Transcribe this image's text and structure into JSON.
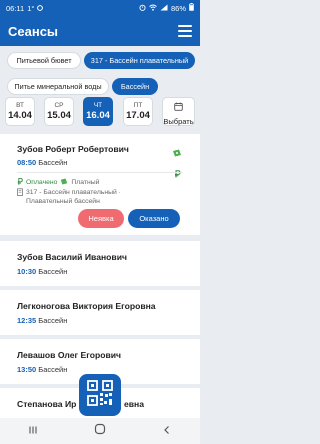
{
  "status": {
    "time": "06:11",
    "indicator": "1°",
    "battery": "86%"
  },
  "header": {
    "title": "Сеансы"
  },
  "filters": [
    {
      "label": "Питьевой бювет",
      "active": false
    },
    {
      "label": "317 - Бассейн плавательный",
      "active": true
    },
    {
      "label": "Питье минеральной воды",
      "active": false
    },
    {
      "label": "Бассейн",
      "active": true
    }
  ],
  "days": [
    {
      "weekday": "ВТ",
      "date": "14.04",
      "active": false
    },
    {
      "weekday": "СР",
      "date": "15.04",
      "active": false
    },
    {
      "weekday": "ЧТ",
      "date": "16.04",
      "active": true
    },
    {
      "weekday": "ПТ",
      "date": "17.04",
      "active": false
    }
  ],
  "date_picker": {
    "label": "Выбрать"
  },
  "sessions": [
    {
      "name": "Зубов Роберт Робертович",
      "time": "08:50",
      "procedure": "Бассейн",
      "expanded": true,
      "payment_status": "Оплачено",
      "payment_type": "Платный",
      "room_line1": "317 - Бассейн плавательный ·",
      "room_line2": "Плавательный бассейн",
      "missed_label": "Неявка",
      "done_label": "Оказано"
    },
    {
      "name": "Зубов Василий Иванович",
      "time": "10:30",
      "procedure": "Бассейн"
    },
    {
      "name": "Легконогова Виктория Егоровна",
      "time": "12:35",
      "procedure": "Бассейн"
    },
    {
      "name": "Левашов Олег Егорович",
      "time": "13:50",
      "procedure": "Бассейн"
    },
    {
      "name": "Степанова Ир",
      "name_tail": "евна",
      "time": "",
      "procedure": ""
    }
  ],
  "colors": {
    "primary": "#1561b8",
    "danger": "#ef6b6f",
    "paid": "#2e8b3c",
    "background": "#e9edf1"
  },
  "icons": {
    "qr": "qr-code-icon",
    "menu": "hamburger-menu-icon",
    "calendar": "calendar-icon",
    "paid": "ruble-icon",
    "room": "building-icon"
  }
}
